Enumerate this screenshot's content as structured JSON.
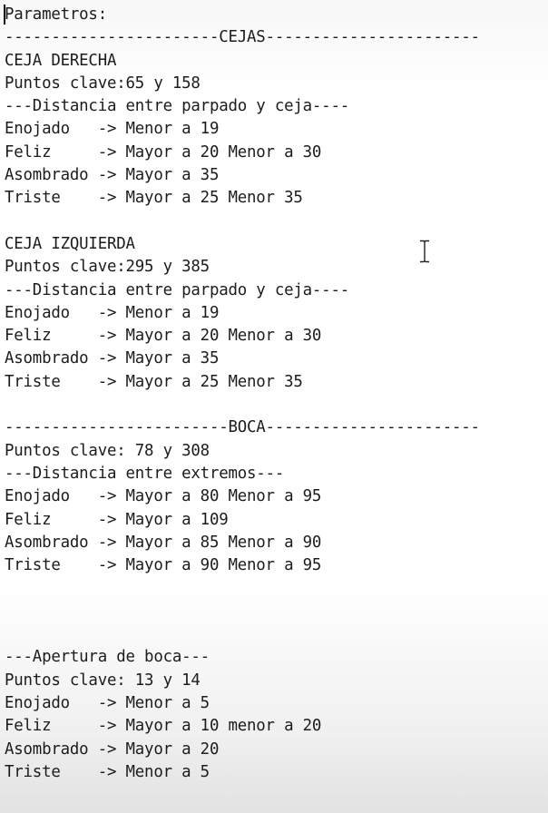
{
  "editor": {
    "lines": [
      "Parametros:",
      "-----------------------CEJAS-----------------------",
      "CEJA DERECHA",
      "Puntos clave:65 y 158",
      "---Distancia entre parpado y ceja----",
      "Enojado   -> Menor a 19",
      "Feliz     -> Mayor a 20 Menor a 30",
      "Asombrado -> Mayor a 35",
      "Triste    -> Mayor a 25 Menor 35",
      "",
      "CEJA IZQUIERDA",
      "Puntos clave:295 y 385",
      "---Distancia entre parpado y ceja----",
      "Enojado   -> Menor a 19",
      "Feliz     -> Mayor a 20 Menor a 30",
      "Asombrado -> Mayor a 35",
      "Triste    -> Mayor a 25 Menor 35",
      "",
      "------------------------BOCA-----------------------",
      "Puntos clave: 78 y 308",
      "---Distancia entre extremos---",
      "Enojado   -> Mayor a 80 Menor a 95",
      "Feliz     -> Mayor a 109",
      "Asombrado -> Mayor a 85 Menor a 90",
      "Triste    -> Mayor a 90 Menor a 95",
      "",
      "",
      "",
      "---Apertura de boca---",
      "Puntos clave: 13 y 14",
      "Enojado   -> Menor a 5",
      "Feliz     -> Mayor a 10 menor a 20",
      "Asombrado -> Mayor a 20",
      "Triste    -> Menor a 5"
    ]
  },
  "cursor": {
    "type": "i-beam-icon"
  }
}
